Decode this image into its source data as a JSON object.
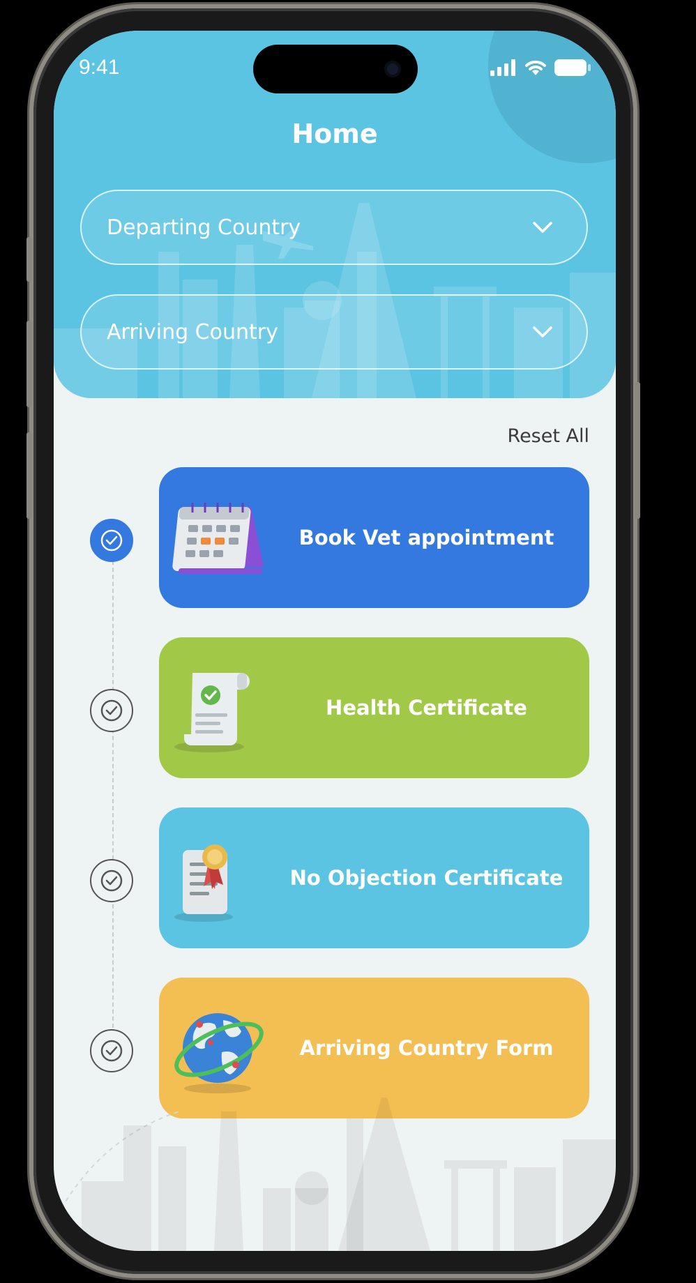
{
  "status_bar": {
    "time": "9:41"
  },
  "header": {
    "title": "Home"
  },
  "selects": {
    "departing": {
      "label": "Departing Country"
    },
    "arriving": {
      "label": "Arriving Country"
    }
  },
  "actions": {
    "reset_label": "Reset All"
  },
  "steps": [
    {
      "label": "Book Vet appointment",
      "color": "#3379e0",
      "completed": true,
      "icon": "calendar-icon"
    },
    {
      "label": "Health Certificate",
      "color": "#a2c848",
      "completed": false,
      "icon": "certificate-scroll-icon"
    },
    {
      "label": "No Objection Certificate",
      "color": "#5bc4e2",
      "completed": false,
      "icon": "document-seal-icon"
    },
    {
      "label": "Arriving Country Form",
      "color": "#f4bf52",
      "completed": false,
      "icon": "globe-icon"
    }
  ],
  "colors": {
    "header": "#5bc4e2",
    "background": "#eef3f4",
    "active_step": "#3379e0"
  }
}
